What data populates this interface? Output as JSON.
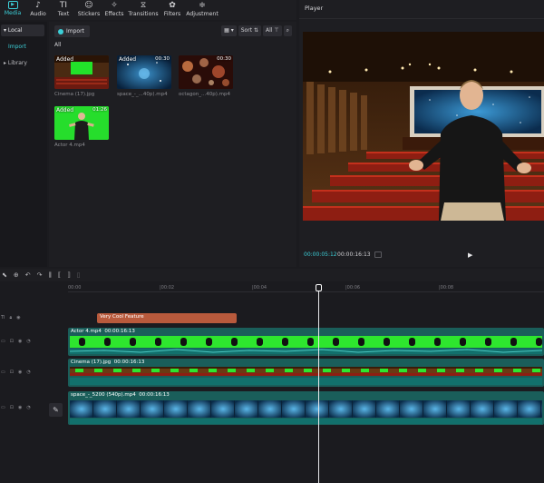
{
  "toolbar": {
    "tabs": [
      {
        "label": "Media",
        "icon": "media-icon"
      },
      {
        "label": "Audio",
        "icon": "audio-icon"
      },
      {
        "label": "Text",
        "icon": "text-icon"
      },
      {
        "label": "Stickers",
        "icon": "stickers-icon"
      },
      {
        "label": "Effects",
        "icon": "effects-icon"
      },
      {
        "label": "Transitions",
        "icon": "transitions-icon"
      },
      {
        "label": "Filters",
        "icon": "filters-icon"
      },
      {
        "label": "Adjustment",
        "icon": "adjustment-icon"
      }
    ],
    "active_tab": "Media"
  },
  "sidebar": {
    "local": "▾ Local",
    "import": "Import",
    "library": "▸ Library"
  },
  "media": {
    "import_label": "Import",
    "sort_label": "Sort",
    "all_filter": "All",
    "all_label": "All",
    "items": [
      {
        "name": "Cinema (17).jpg",
        "badge": "Added",
        "duration": ""
      },
      {
        "name": "space_-_...40p).mp4",
        "badge": "Added",
        "duration": "00:30"
      },
      {
        "name": "octagon_...40p).mp4",
        "badge": "",
        "duration": "00:30"
      },
      {
        "name": "Actor 4.mp4",
        "badge": "Added",
        "duration": "01:26"
      }
    ]
  },
  "player": {
    "title": "Player",
    "current_time": "00:00:05:12",
    "total_time": "00:00:16:13"
  },
  "timeline": {
    "ruler": [
      "00:00",
      "|00:02",
      "|00:04",
      "|00:06",
      "|00:08"
    ],
    "text_clip": "Very Cool Feature",
    "tracks": [
      {
        "name": "Actor 4.mp4",
        "duration": "00:00:16:13"
      },
      {
        "name": "Cinema (17).jpg",
        "duration": "00:00:16:13"
      },
      {
        "name": "space_-_5200 (540p).mp4",
        "duration": "00:00:16:13"
      }
    ]
  },
  "colors": {
    "accent": "#3ccfd8",
    "green_screen": "#2ee62e",
    "text_clip": "#b85a3c",
    "track_bg": "#1f6d6a"
  }
}
